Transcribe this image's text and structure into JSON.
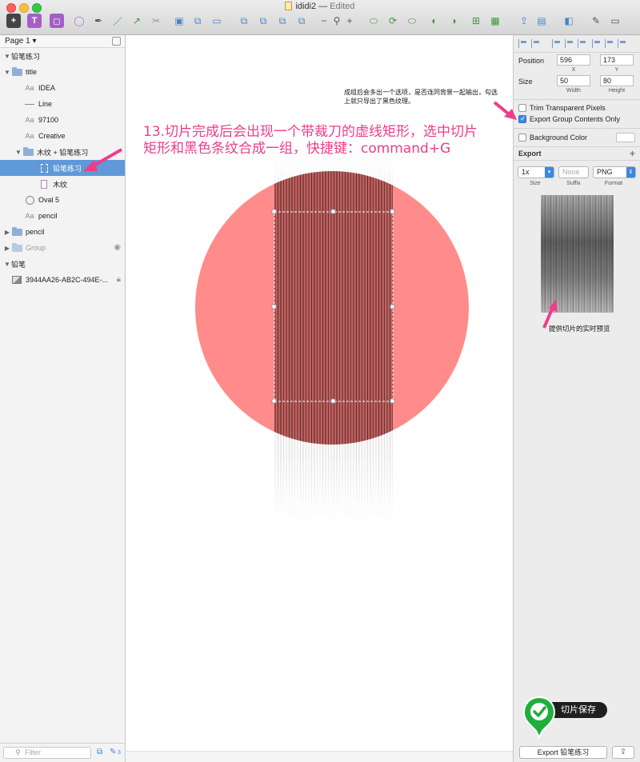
{
  "window": {
    "doc_name": "ididi2",
    "separator": "—",
    "status": "Edited"
  },
  "sidebar": {
    "page": "Page 1",
    "layers": [
      {
        "label": "铅笔练习",
        "kind": "page-header"
      },
      {
        "label": "title",
        "kind": "folder"
      },
      {
        "label": "IDEA",
        "kind": "text"
      },
      {
        "label": "Line",
        "kind": "line"
      },
      {
        "label": "97100",
        "kind": "text"
      },
      {
        "label": "Creative",
        "kind": "text"
      },
      {
        "label": "木纹 + 铅笔练习",
        "kind": "folder"
      },
      {
        "label": "铅笔练习",
        "kind": "slice",
        "selected": true
      },
      {
        "label": "木纹",
        "kind": "rect"
      },
      {
        "label": "Oval 5",
        "kind": "oval"
      },
      {
        "label": "pencil",
        "kind": "text"
      },
      {
        "label": "pencil",
        "kind": "folder"
      },
      {
        "label": "Group",
        "kind": "folder"
      },
      {
        "label": "铅笔",
        "kind": "page-header"
      },
      {
        "label": "3944AA26-AB2C-494E-...",
        "kind": "bitmap"
      }
    ],
    "filter_placeholder": "Filter",
    "count_badge": "3"
  },
  "inspector": {
    "position_label": "Position",
    "x_value": "596",
    "y_value": "173",
    "x_caption": "X",
    "y_caption": "Y",
    "size_label": "Size",
    "width_value": "50",
    "height_value": "80",
    "width_caption": "Width",
    "height_caption": "Height",
    "trim_label": "Trim Transparent Pixels",
    "export_group_label": "Export Group Contents Only",
    "bg_color_label": "Background Color",
    "export_header": "Export",
    "scale_value": "1x",
    "suffix_placeholder": "None",
    "format_value": "PNG",
    "size_caption": "Size",
    "suffix_caption": "Suffix",
    "format_caption": "Format",
    "export_button": "Export 铅笔练习"
  },
  "annotations": {
    "main_line1": "13.切片完成后会出现一个带裁刀的虚线矩形，选中切片",
    "main_line2": "矩形和黑色条纹合成一组，快捷键：command+G",
    "note": "成组后会多出一个选项，是否连同背景一起输出，勾选上就只导出了黑色纹理。",
    "preview_note": "提供切片的实时预览",
    "save_label": "切片保存"
  },
  "colors": {
    "circle": "#ff8c8a",
    "annotation": "#ee3d8b",
    "selection": "#5f99d9"
  }
}
